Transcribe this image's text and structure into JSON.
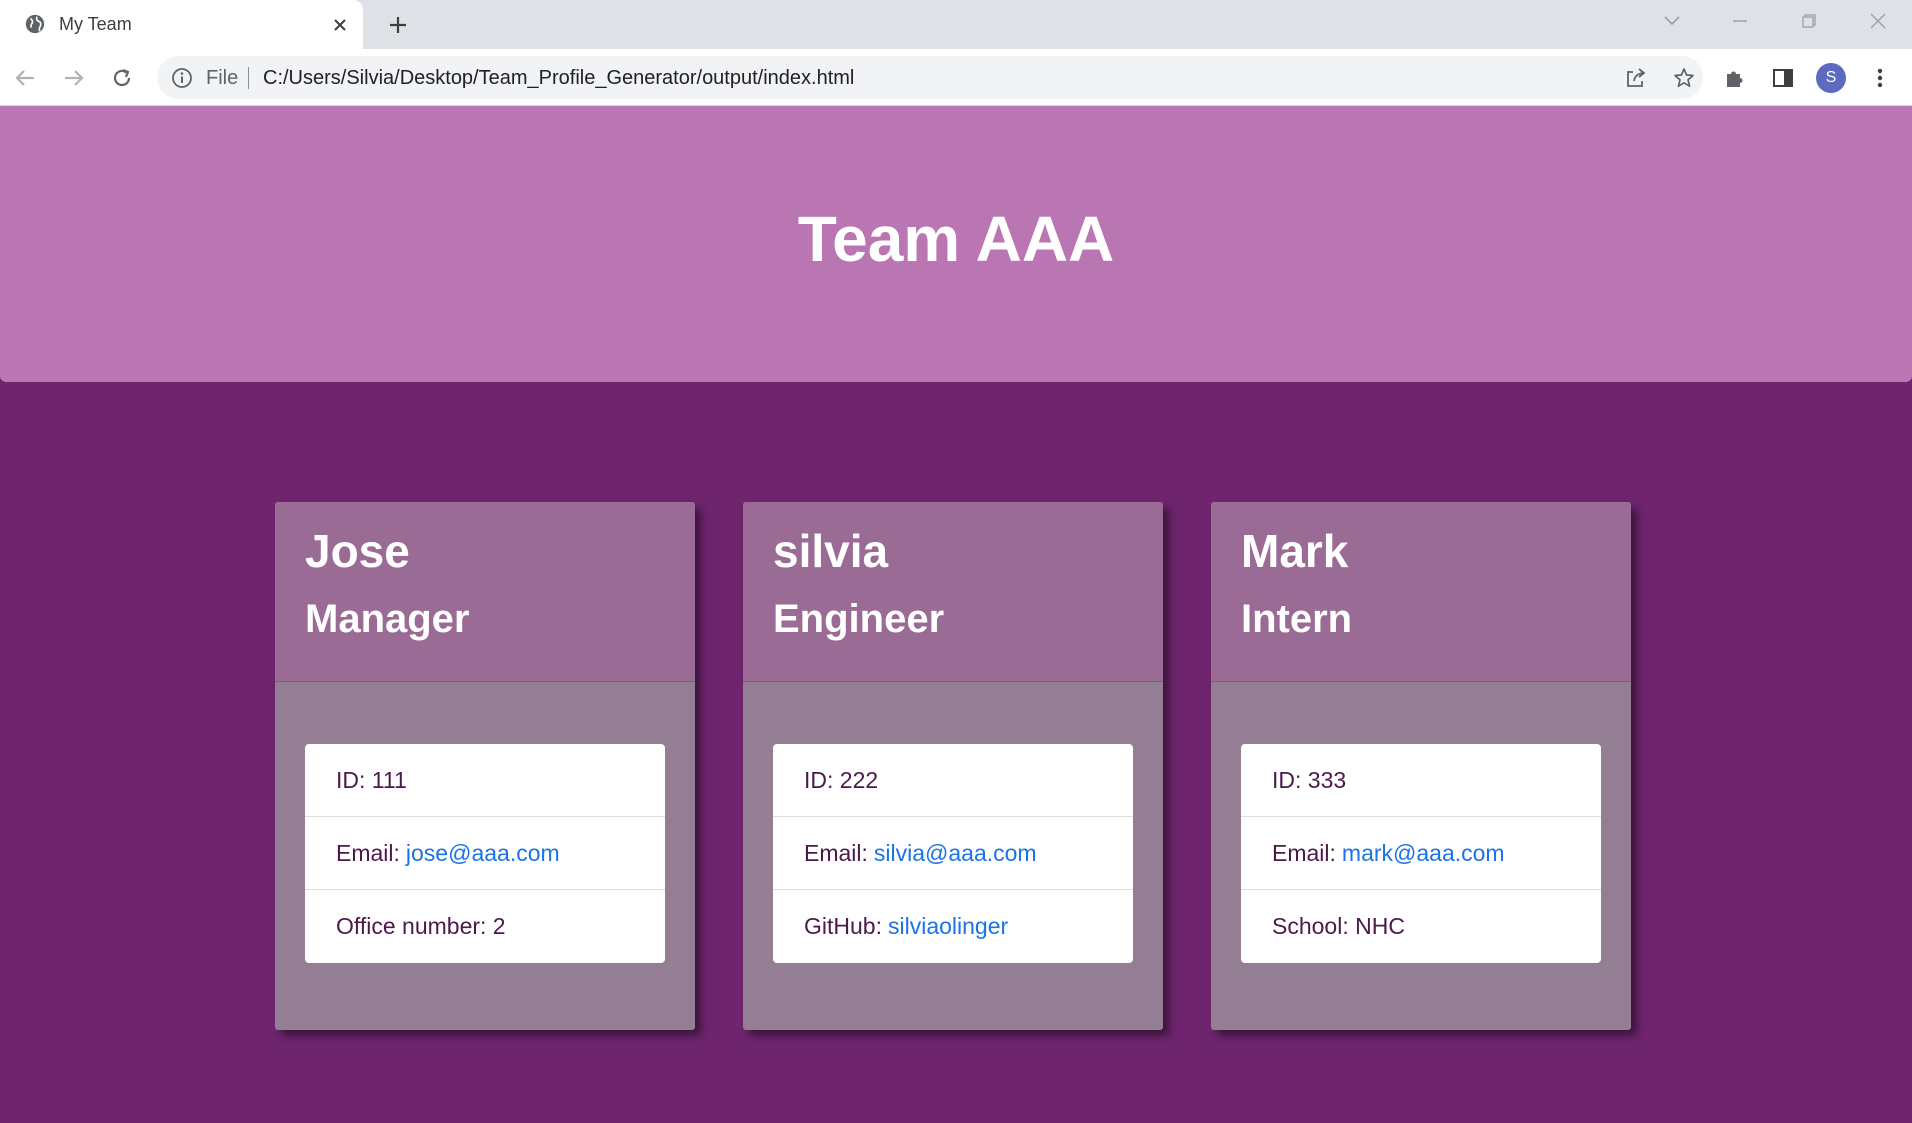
{
  "browser": {
    "tab_title": "My Team",
    "file_label": "File",
    "url": "C:/Users/Silvia/Desktop/Team_Profile_Generator/output/index.html",
    "profile_initial": "S"
  },
  "page": {
    "title": "Team AAA",
    "colors": {
      "header_bg": "#b976b2",
      "page_bg": "#6e256e",
      "card_head": "#9a6b95",
      "card_body": "#937e94",
      "link": "#1a73e8"
    }
  },
  "cards": [
    {
      "name": "Jose",
      "role": "Manager",
      "id_line": "ID: 111",
      "email_label": "Email:",
      "email": "jose@aaa.com",
      "extra_label": "Office number: 2",
      "extra_link": ""
    },
    {
      "name": "silvia",
      "role": "Engineer",
      "id_line": "ID: 222",
      "email_label": "Email:",
      "email": "silvia@aaa.com",
      "extra_label": "GitHub:",
      "extra_link": "silviaolinger"
    },
    {
      "name": "Mark",
      "role": "Intern",
      "id_line": "ID: 333",
      "email_label": "Email:",
      "email": "mark@aaa.com",
      "extra_label": "School: NHC",
      "extra_link": ""
    }
  ]
}
